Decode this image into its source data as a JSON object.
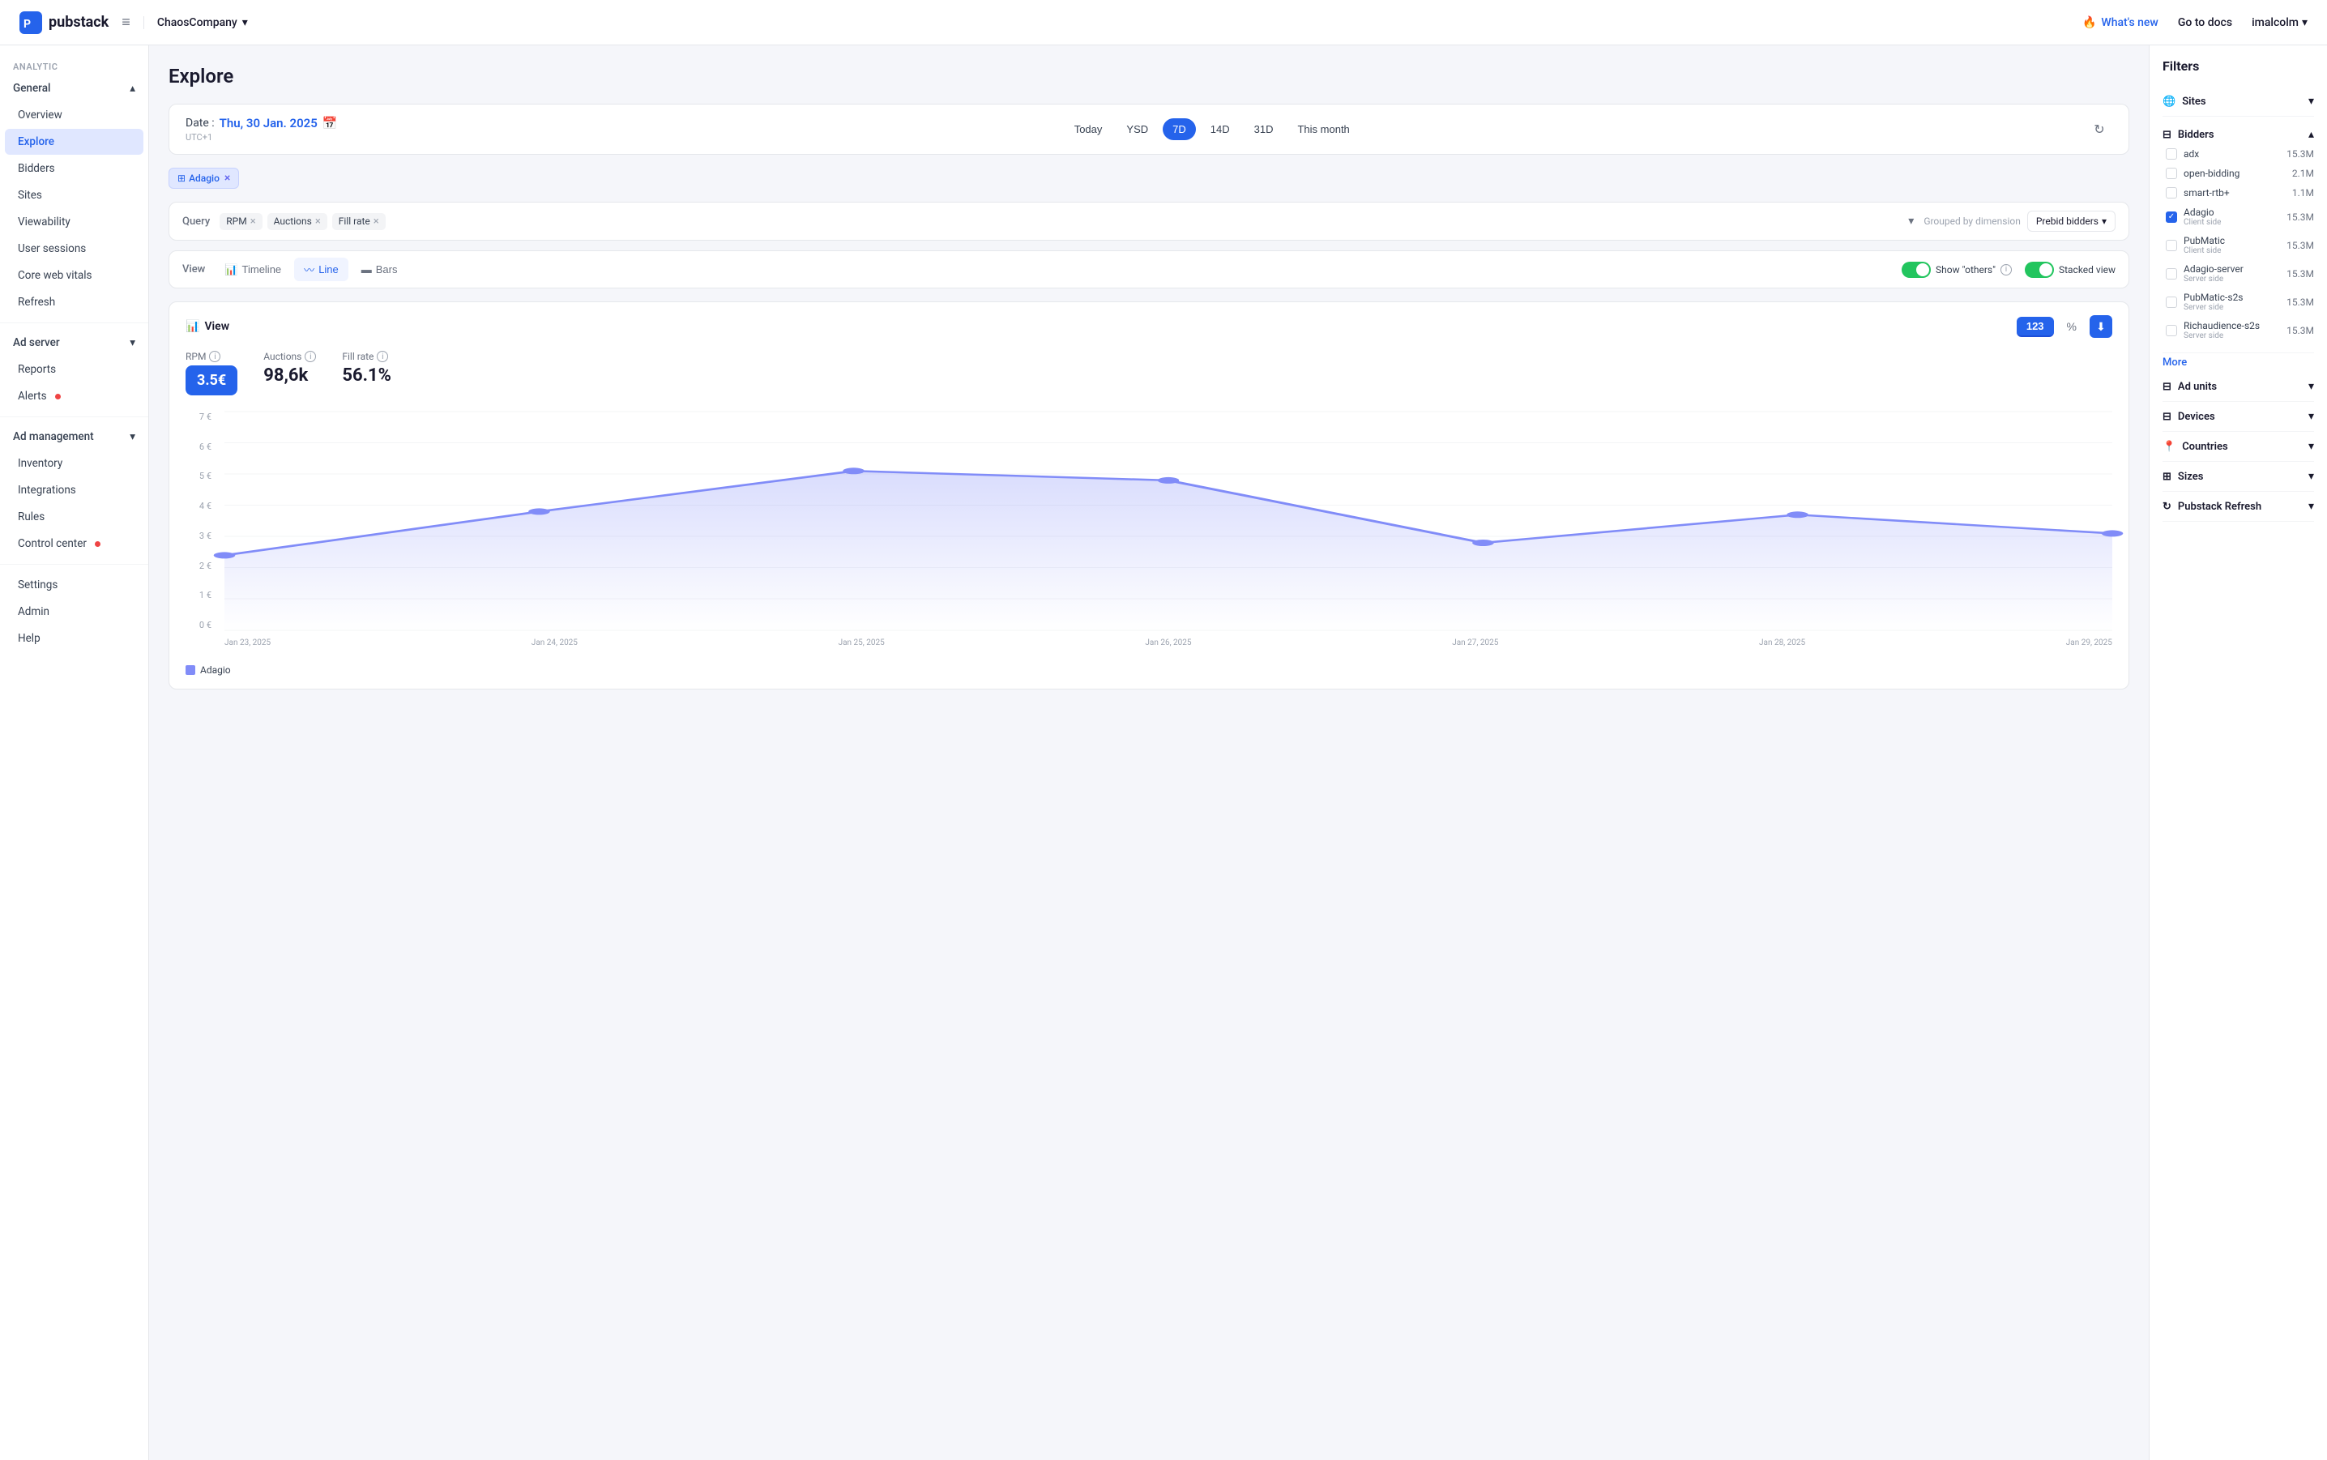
{
  "app": {
    "logo_text": "pubstack",
    "menu_icon": "≡"
  },
  "topbar": {
    "company": "ChaosCompany",
    "company_chevron": "▾",
    "whats_new": "What's new",
    "go_to_docs": "Go to docs",
    "user": "imalcolm",
    "user_chevron": "▾"
  },
  "sidebar": {
    "analytic_label": "Analytic",
    "general_label": "General",
    "items_general": [
      {
        "id": "overview",
        "label": "Overview"
      },
      {
        "id": "explore",
        "label": "Explore",
        "active": true
      },
      {
        "id": "bidders",
        "label": "Bidders"
      },
      {
        "id": "sites",
        "label": "Sites"
      },
      {
        "id": "viewability",
        "label": "Viewability"
      },
      {
        "id": "user-sessions",
        "label": "User sessions"
      },
      {
        "id": "core-web-vitals",
        "label": "Core web vitals"
      },
      {
        "id": "refresh",
        "label": "Refresh"
      }
    ],
    "ad_server_label": "Ad server",
    "items_ad_server": [
      {
        "id": "reports",
        "label": "Reports"
      },
      {
        "id": "alerts",
        "label": "Alerts",
        "dot": true
      }
    ],
    "ad_management_label": "Ad management",
    "items_ad_management": [
      {
        "id": "inventory",
        "label": "Inventory"
      },
      {
        "id": "integrations",
        "label": "Integrations"
      },
      {
        "id": "rules",
        "label": "Rules"
      },
      {
        "id": "control-center",
        "label": "Control center",
        "dot": true
      }
    ],
    "items_bottom": [
      {
        "id": "settings",
        "label": "Settings"
      },
      {
        "id": "admin",
        "label": "Admin"
      },
      {
        "id": "help",
        "label": "Help"
      }
    ]
  },
  "explore": {
    "page_title": "Explore",
    "date_label": "Date :",
    "date_value": "Thu, 30 Jan. 2025",
    "date_tz": "UTC+1",
    "presets": [
      "Today",
      "YSD",
      "7D",
      "14D",
      "31D",
      "This month"
    ],
    "active_preset": "7D",
    "filter_tag_label": "Adagio",
    "filter_tag_icon": "⊞",
    "query_label": "Query",
    "query_tags": [
      "RPM",
      "Auctions",
      "Fill rate"
    ],
    "group_label": "Grouped by dimension",
    "group_value": "Prebid bidders",
    "view_label": "View",
    "view_tabs": [
      {
        "id": "timeline",
        "label": "Timeline",
        "icon": "📊"
      },
      {
        "id": "line",
        "label": "Line",
        "icon": "〰",
        "active": true
      },
      {
        "id": "bars",
        "label": "Bars",
        "icon": "▬"
      }
    ],
    "toggle_others_label": "Show \"others\"",
    "toggle_stacked_label": "Stacked view",
    "chart_title": "View",
    "value_btn": "123",
    "pct_btn": "%",
    "metrics": [
      {
        "id": "rpm",
        "label": "RPM",
        "value": "3.5€",
        "highlight": true
      },
      {
        "id": "auctions",
        "label": "Auctions",
        "value": "98,6k",
        "highlight": false
      },
      {
        "id": "fill-rate",
        "label": "Fill rate",
        "value": "56.1%",
        "highlight": false
      }
    ],
    "chart": {
      "yaxis": [
        "7 €",
        "6 €",
        "5 €",
        "4 €",
        "3 €",
        "2 €",
        "1 €",
        "0 €"
      ],
      "xaxis": [
        "Jan 23, 2025",
        "Jan 24, 2025",
        "Jan 25, 2025",
        "Jan 26, 2025",
        "Jan 27, 2025",
        "Jan 28, 2025",
        "Jan 29, 2025"
      ],
      "line_points": [
        {
          "x": 0,
          "y": 2.4
        },
        {
          "x": 1,
          "y": 3.8
        },
        {
          "x": 2,
          "y": 5.1
        },
        {
          "x": 3,
          "y": 4.8
        },
        {
          "x": 4,
          "y": 2.8
        },
        {
          "x": 5,
          "y": 3.7
        },
        {
          "x": 6,
          "y": 3.1
        }
      ],
      "y_min": 0,
      "y_max": 7
    },
    "legend_label": "Adagio"
  },
  "filters": {
    "title": "Filters",
    "sites_label": "Sites",
    "bidders_label": "Bidders",
    "bidders_expanded": true,
    "bidder_items": [
      {
        "id": "adx",
        "name": "adx",
        "sub": "",
        "count": "15.3M",
        "checked": false
      },
      {
        "id": "open-bidding",
        "name": "open-bidding",
        "sub": "",
        "count": "2.1M",
        "checked": false
      },
      {
        "id": "smart-rtb",
        "name": "smart-rtb+",
        "sub": "",
        "count": "1.1M",
        "checked": false
      },
      {
        "id": "adagio",
        "name": "Adagio",
        "sub": "Client side",
        "count": "15.3M",
        "checked": true
      },
      {
        "id": "pubmatic",
        "name": "PubMatic",
        "sub": "Client side",
        "count": "15.3M",
        "checked": false
      },
      {
        "id": "adagio-server",
        "name": "Adagio-server",
        "sub": "Server side",
        "count": "15.3M",
        "checked": false
      },
      {
        "id": "pubmatic-s2s",
        "name": "PubMatic-s2s",
        "sub": "Server side",
        "count": "15.3M",
        "checked": false
      },
      {
        "id": "richaudience-s2s",
        "name": "Richaudience-s2s",
        "sub": "Server side",
        "count": "15.3M",
        "checked": false
      }
    ],
    "more_label": "More",
    "collapsed_sections": [
      {
        "id": "ad-units",
        "label": "Ad units",
        "icon": "⊟"
      },
      {
        "id": "devices",
        "label": "Devices",
        "icon": "⊟"
      },
      {
        "id": "countries",
        "label": "Countries",
        "icon": "📍"
      },
      {
        "id": "sizes",
        "label": "Sizes",
        "icon": "⊞"
      },
      {
        "id": "pubstack-refresh",
        "label": "Pubstack Refresh",
        "icon": "↻"
      }
    ]
  }
}
